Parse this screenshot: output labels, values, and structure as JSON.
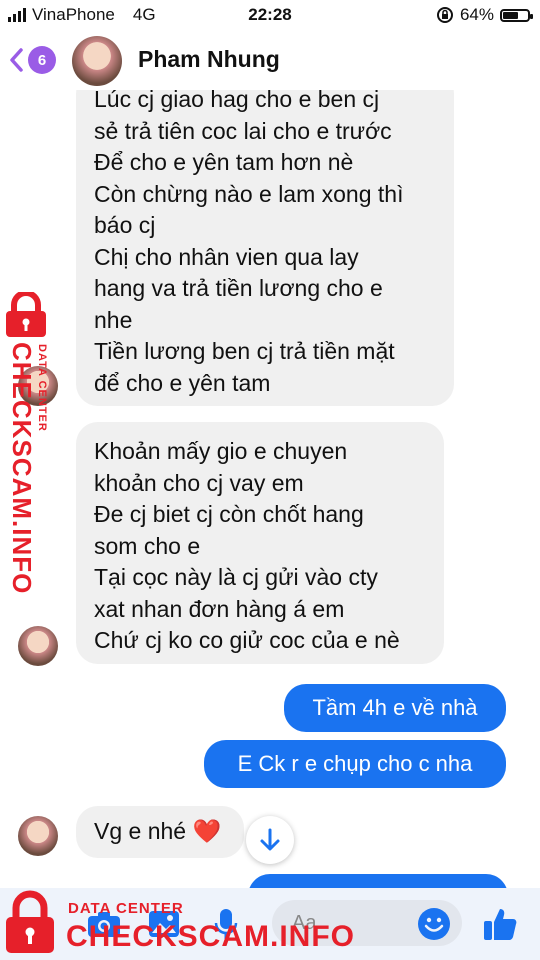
{
  "status_bar": {
    "carrier": "VinaPhone",
    "network": "4G",
    "time": "22:28",
    "battery_percent": "64%",
    "battery_level": 0.64
  },
  "header": {
    "back_badge": "6",
    "contact_name": "Pham Nhung"
  },
  "messages": [
    {
      "direction": "incoming",
      "lines": [
        "Lúc cj giao hag cho e ben cj",
        "sẻ trả tiên coc lai cho e trước",
        "Để cho e yên tam hơn nè",
        "Còn chừng nào e lam xong thì",
        "báo cj",
        "Chị cho nhân vien qua lay",
        "hang va trả tiền lương cho e",
        "nhe",
        "Tiền lương ben cj trả tiền mặt",
        "để cho e yên tam"
      ]
    },
    {
      "direction": "incoming",
      "lines": [
        "Khoản mấy gio e chuyen",
        "khoản cho cj vay em",
        "Đe cj biet cj còn chốt hang",
        "som cho e",
        "Tại cọc này là cj gửi vào cty",
        "xat nhan đơn hàng á em",
        "Chứ cj ko co giử coc của e nè"
      ]
    },
    {
      "direction": "outgoing",
      "text": "Tầm 4h e về nhà"
    },
    {
      "direction": "outgoing",
      "text": "E Ck r e chụp cho c nha"
    },
    {
      "direction": "incoming",
      "text": "Vg e nhé ❤️"
    }
  ],
  "composer": {
    "placeholder": "Aa",
    "icons": [
      "camera-icon",
      "image-icon",
      "microphone-icon",
      "emoji-icon",
      "like-icon"
    ]
  },
  "watermark": {
    "small_text": "DATA CENTER",
    "big_text": "CHECKSCAM.INFO",
    "color": "#e6202a"
  },
  "colors": {
    "accent": "#1a73f0",
    "incoming_bubble": "#f0f0f0",
    "back_badge": "#9a5ce6"
  }
}
